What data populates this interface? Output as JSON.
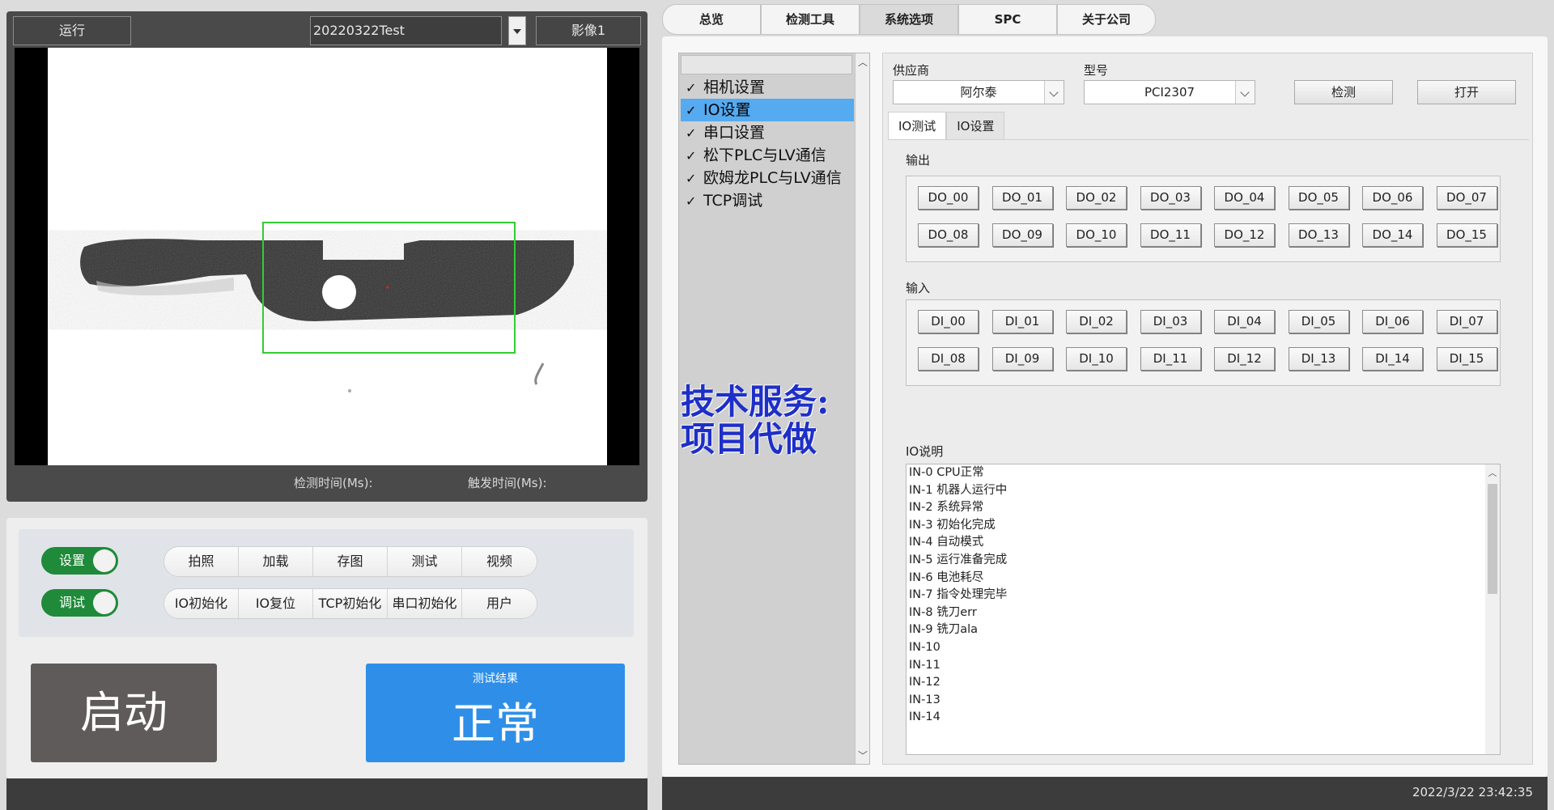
{
  "camera": {
    "run_label": "运行",
    "recipe_value": "20220322Test",
    "image_label": "影像1",
    "detect_time_label": "检测时间(Ms):",
    "trigger_time_label": "触发时间(Ms):"
  },
  "controls": {
    "toggle_setup": "设置",
    "toggle_debug": "调试",
    "row1": [
      "拍照",
      "加载",
      "存图",
      "测试",
      "视频"
    ],
    "row2": [
      "IO初始化",
      "IO复位",
      "TCP初始化",
      "串口初始化",
      "用户"
    ],
    "start_label": "启动",
    "result_title": "测试结果",
    "result_value": "正常"
  },
  "main_tabs": [
    "总览",
    "检测工具",
    "系统选项",
    "SPC",
    "关于公司"
  ],
  "tree": {
    "check": "✓",
    "items": [
      "相机设置",
      "IO设置",
      "串口设置",
      "松下PLC与LV通信",
      "欧姆龙PLC与LV通信",
      "TCP调试"
    ]
  },
  "watermark": {
    "line1": "技术服务:",
    "line2": "项目代做"
  },
  "io_config": {
    "supplier_label": "供应商",
    "supplier_value": "阿尔泰",
    "model_label": "型号",
    "model_value": "PCI2307",
    "detect_button": "检测",
    "open_button": "打开",
    "subtabs": [
      "IO测试",
      "IO设置"
    ],
    "output_label": "输出",
    "outputs": [
      "DO_00",
      "DO_01",
      "DO_02",
      "DO_03",
      "DO_04",
      "DO_05",
      "DO_06",
      "DO_07",
      "DO_08",
      "DO_09",
      "DO_10",
      "DO_11",
      "DO_12",
      "DO_13",
      "DO_14",
      "DO_15"
    ],
    "input_label": "输入",
    "inputs": [
      "DI_00",
      "DI_01",
      "DI_02",
      "DI_03",
      "DI_04",
      "DI_05",
      "DI_06",
      "DI_07",
      "DI_08",
      "DI_09",
      "DI_10",
      "DI_11",
      "DI_12",
      "DI_13",
      "DI_14",
      "DI_15"
    ],
    "desc_label": "IO说明",
    "desc_lines": [
      "IN-0 CPU正常",
      "IN-1 机器人运行中",
      "IN-2 系统异常",
      "IN-3 初始化完成",
      "IN-4 自动模式",
      "IN-5 运行准备完成",
      "IN-6 电池耗尽",
      "IN-7 指令处理完毕",
      "IN-8 铣刀err",
      "IN-9 铣刀ala",
      "IN-10",
      "IN-11",
      "IN-12",
      "IN-13",
      "IN-14"
    ]
  },
  "footer": {
    "datetime": "2022/3/22 23:42:35"
  }
}
